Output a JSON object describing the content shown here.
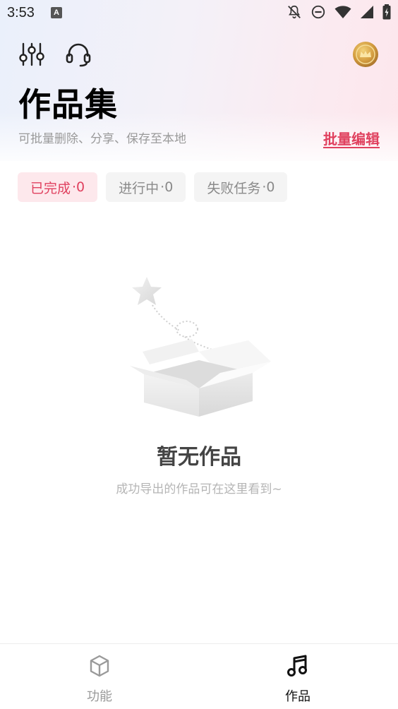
{
  "status_bar": {
    "time": "3:53",
    "notification_letter": "A"
  },
  "header": {
    "title": "作品集",
    "subtitle": "可批量删除、分享、保存至本地",
    "batch_edit_label": "批量编辑"
  },
  "tabs": [
    {
      "label": "已完成",
      "count": "·0",
      "active": true
    },
    {
      "label": "进行中",
      "count": "·0",
      "active": false
    },
    {
      "label": "失败任务",
      "count": "·0",
      "active": false
    }
  ],
  "empty_state": {
    "title": "暂无作品",
    "description": "成功导出的作品可在这里看到~"
  },
  "bottom_nav": [
    {
      "label": "功能",
      "icon": "cube-icon",
      "active": false
    },
    {
      "label": "作品",
      "icon": "music-note-icon",
      "active": true
    }
  ],
  "colors": {
    "accent": "#e0415f",
    "accent_bg": "#fde8ec",
    "coin_gold": "#c9953c"
  }
}
